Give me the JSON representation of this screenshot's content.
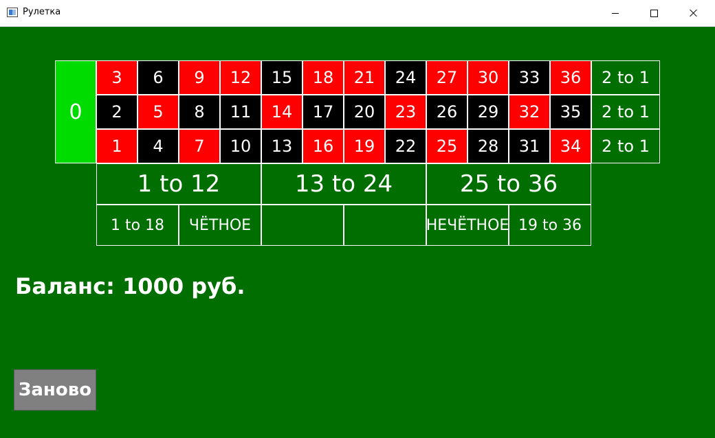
{
  "window": {
    "title": "Рулетка",
    "controls": [
      "minimize",
      "maximize",
      "close"
    ]
  },
  "board": {
    "zero": "0",
    "rows": [
      [
        {
          "n": "3",
          "color": "red"
        },
        {
          "n": "6",
          "color": "black"
        },
        {
          "n": "9",
          "color": "red"
        },
        {
          "n": "12",
          "color": "red"
        },
        {
          "n": "15",
          "color": "black"
        },
        {
          "n": "18",
          "color": "red"
        },
        {
          "n": "21",
          "color": "red"
        },
        {
          "n": "24",
          "color": "black"
        },
        {
          "n": "27",
          "color": "red"
        },
        {
          "n": "30",
          "color": "red"
        },
        {
          "n": "33",
          "color": "black"
        },
        {
          "n": "36",
          "color": "red"
        }
      ],
      [
        {
          "n": "2",
          "color": "black"
        },
        {
          "n": "5",
          "color": "red"
        },
        {
          "n": "8",
          "color": "black"
        },
        {
          "n": "11",
          "color": "black"
        },
        {
          "n": "14",
          "color": "red"
        },
        {
          "n": "17",
          "color": "black"
        },
        {
          "n": "20",
          "color": "black"
        },
        {
          "n": "23",
          "color": "red"
        },
        {
          "n": "26",
          "color": "black"
        },
        {
          "n": "29",
          "color": "black"
        },
        {
          "n": "32",
          "color": "red"
        },
        {
          "n": "35",
          "color": "black"
        }
      ],
      [
        {
          "n": "1",
          "color": "red"
        },
        {
          "n": "4",
          "color": "black"
        },
        {
          "n": "7",
          "color": "red"
        },
        {
          "n": "10",
          "color": "black"
        },
        {
          "n": "13",
          "color": "black"
        },
        {
          "n": "16",
          "color": "red"
        },
        {
          "n": "19",
          "color": "red"
        },
        {
          "n": "22",
          "color": "black"
        },
        {
          "n": "25",
          "color": "red"
        },
        {
          "n": "28",
          "color": "black"
        },
        {
          "n": "31",
          "color": "black"
        },
        {
          "n": "34",
          "color": "red"
        }
      ]
    ],
    "column_bets": [
      "2 to 1",
      "2 to 1",
      "2 to 1"
    ],
    "dozens": [
      "1 to 12",
      "13 to 24",
      "25 to 36"
    ],
    "outside": [
      {
        "label": "1 to 18",
        "color": ""
      },
      {
        "label": "ЧЁТНОЕ",
        "color": ""
      },
      {
        "label": "",
        "color": "red"
      },
      {
        "label": "",
        "color": "black"
      },
      {
        "label": "НЕЧЁТНОЕ",
        "color": ""
      },
      {
        "label": "19 to 36",
        "color": ""
      }
    ]
  },
  "balance": {
    "text": "Баланс: 1000 руб."
  },
  "restart_button": {
    "label": "Заново"
  },
  "colors": {
    "felt": "#006e00",
    "zero": "#00dc00",
    "red": "#ff0000",
    "black": "#000000",
    "button": "#808080"
  }
}
